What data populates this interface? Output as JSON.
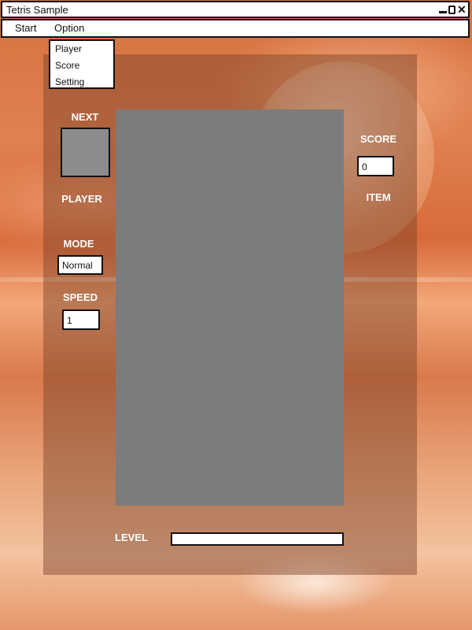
{
  "window": {
    "title": "Tetris Sample",
    "controls": [
      "minimize-icon",
      "maximize-icon",
      "close-icon"
    ],
    "close_glyph": "✕"
  },
  "menu": {
    "items": [
      "Start",
      "Option"
    ],
    "open_menu": "Option",
    "dropdown": [
      "Player",
      "Score",
      "Setting"
    ]
  },
  "sidebar_left": {
    "next_label": "NEXT",
    "player_label": "PLAYER",
    "mode_label": "MODE",
    "mode_value": "Normal",
    "speed_label": "SPEED",
    "speed_value": "1"
  },
  "sidebar_right": {
    "score_label": "SCORE",
    "score_value": "0",
    "item_label": "ITEM"
  },
  "footer": {
    "level_label": "LEVEL",
    "level_progress": 0
  },
  "colors": {
    "board": "#7c7c7c",
    "next_box": "#8c8c8c",
    "panel_overlay": "rgba(120, 65, 40, 0.45)",
    "label_text": "#ffffff"
  }
}
